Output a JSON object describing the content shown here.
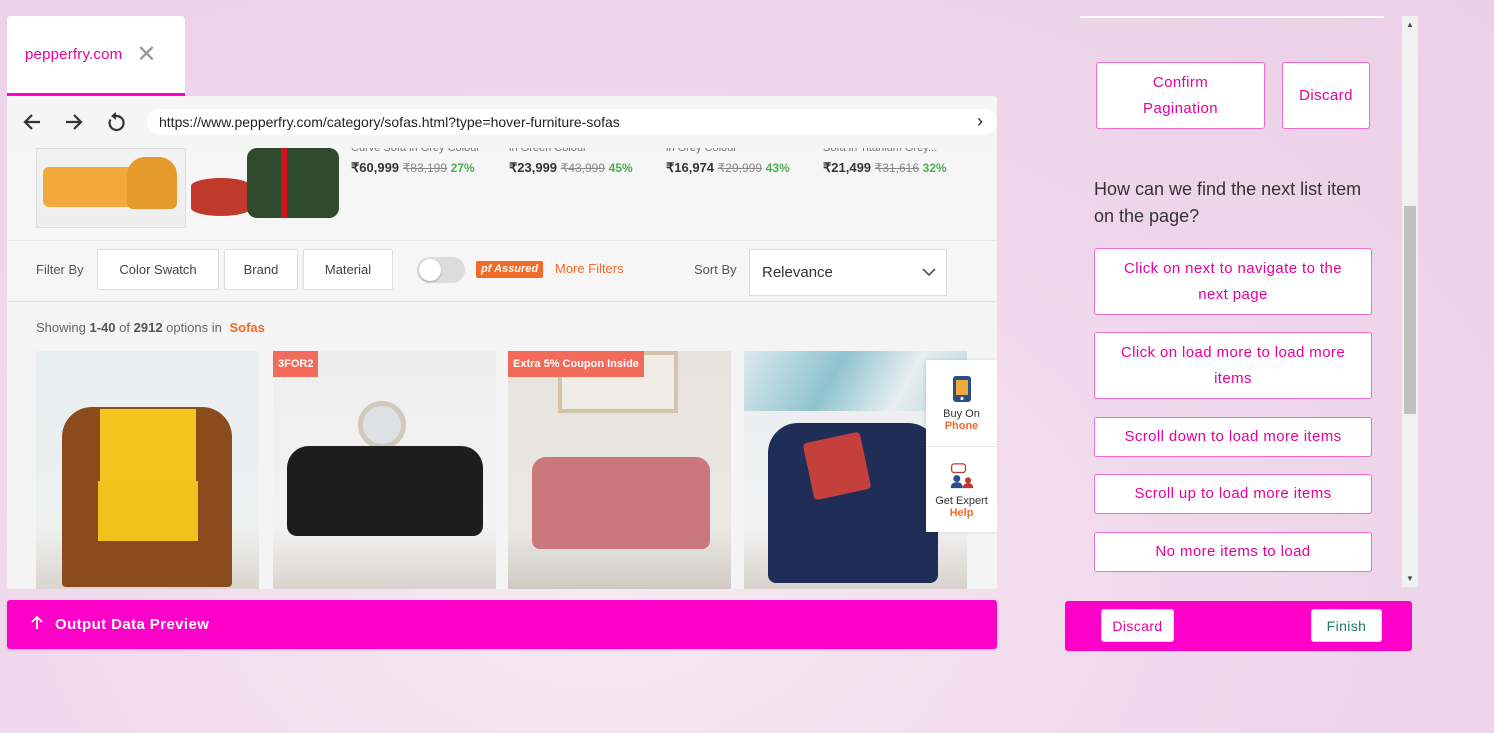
{
  "tab": {
    "label": "pepperfry.com",
    "close_icon": "close-icon"
  },
  "browser": {
    "url": "https://www.pepperfry.com/category/sofas.html?type=hover-furniture-sofas"
  },
  "promo_deals": [
    {
      "caption": "Curve Sofa in Grey Colour",
      "price": "₹60,999",
      "mrp": "₹83,199",
      "off": "27%"
    },
    {
      "caption": "in Green Colour",
      "price": "₹23,999",
      "mrp": "₹43,999",
      "off": "45%"
    },
    {
      "caption": "in Grey Colour",
      "price": "₹16,974",
      "mrp": "₹29,999",
      "off": "43%"
    },
    {
      "caption": "Sofa in Titanium Grey...",
      "price": "₹21,499",
      "mrp": "₹31,616",
      "off": "32%"
    }
  ],
  "filters": {
    "filter_by": "Filter By",
    "chips": [
      "Color Swatch",
      "Brand",
      "Material"
    ],
    "pf_assured": "pf Assured",
    "more_filters": "More Filters",
    "sort_by": "Sort By",
    "sort_value": "Relevance"
  },
  "listing": {
    "showing_prefix": "Showing",
    "range": "1-40",
    "of": "of",
    "total": "2912",
    "options_in": "options in",
    "category": "Sofas",
    "badges": {
      "card2": "3FOR2",
      "card3": "Extra 5% Coupon Inside"
    }
  },
  "side_widget": {
    "buy_line1": "Buy On",
    "buy_line2": "Phone",
    "expert_line1": "Get Expert",
    "expert_line2": "Help"
  },
  "output_bar": {
    "label": "Output Data Preview"
  },
  "right_panel": {
    "confirm_label": "Confirm Pagination",
    "discard_label": "Discard",
    "question": "How can we find the next list item on the page?",
    "options": [
      "Click on next to navigate to the next page",
      "Click on load more to load more items",
      "Scroll down to load more items",
      "Scroll up to load more items",
      "No more items to load"
    ]
  },
  "footer": {
    "discard_label": "Discard",
    "finish_label": "Finish"
  },
  "colors": {
    "accent": "#ff00c8",
    "accent_text": "#e6009e",
    "pf_orange": "#f26a2a",
    "discount_green": "#4caf50"
  }
}
